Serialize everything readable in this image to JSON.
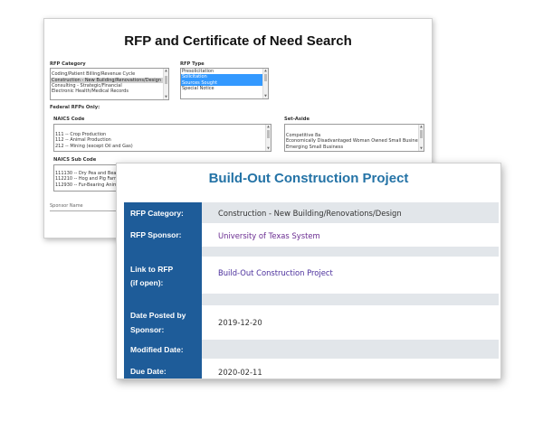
{
  "search_form": {
    "title": "RFP and Certificate of Need Search",
    "rfp_category": {
      "label": "RFP Category",
      "options": [
        "Coding/Patient Billing/Revenue Cycle",
        "Construction - New Building/Renovations/Design",
        "Consulting - Strategic/Financial",
        "Electronic Health/Medical Records"
      ],
      "selected": "Construction - New Building/Renovations/Design"
    },
    "rfp_type": {
      "label": "RFP Type",
      "options": [
        "Presolicitation",
        "Solicitation",
        "Sources Sought",
        "Special Notice"
      ],
      "selected": [
        "Solicitation",
        "Sources Sought"
      ]
    },
    "federal_label": "Federal RFPs Only:",
    "naics_code": {
      "label": "NAICS Code",
      "options": [
        "111 -- Crop Production",
        "112 -- Animal Production",
        "212 -- Mining (except Oil and Gas)"
      ]
    },
    "set_aside": {
      "label": "Set-Aside",
      "options": [
        "Competitive 8a",
        "Economically Disadvantaged Woman Owned Small Business",
        "Emerging Small Business"
      ]
    },
    "naics_sub_code": {
      "label": "NAICS Sub Code",
      "options": [
        "111130 -- Dry Pea and Bean",
        "112210 -- Hog and Pig Farm",
        "112930 -- Fur-Bearing Anim"
      ]
    },
    "sponsor_name_placeholder": "Sponsor Name"
  },
  "project": {
    "title": "Build-Out Construction Project",
    "fields": [
      {
        "label": "RFP Category:",
        "value": "Construction - New Building/Renovations/Design"
      },
      {
        "label": "RFP Sponsor:",
        "value": "University of Texas System"
      },
      {
        "label_line1": "Link to RFP",
        "label_line2": "(if open):",
        "value": "Build-Out Construction Project"
      },
      {
        "label_line1": "Date Posted by",
        "label_line2": "Sponsor:",
        "value": "2019-12-20"
      },
      {
        "label": "Modified Date:",
        "value": ""
      },
      {
        "label": "Due Date:",
        "value": "2020-02-11"
      }
    ]
  },
  "colors": {
    "label_bg": "#1e5c99",
    "title_blue": "#2473a6",
    "row_gray": "#e2e6ea",
    "select_blue": "#3399ff",
    "link_purple": "#6a2c91"
  }
}
